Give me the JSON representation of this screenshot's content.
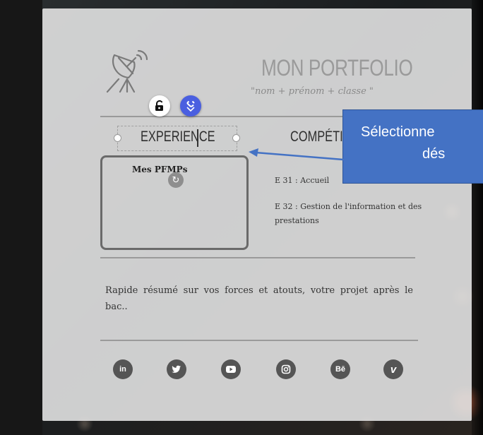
{
  "portfolio": {
    "title": "MON PORTFOLIO",
    "subtitle": "\"nom + prénom + classe \""
  },
  "nav": {
    "experience": "EXPERIENCE",
    "competences": "COMPÉTI"
  },
  "experience_box": {
    "title": "Mes PFMPs"
  },
  "competences": {
    "items": [
      "E 31 : Accueil",
      "E 32 : Gestion de l'information et des prestations"
    ]
  },
  "callout": {
    "line1": "Sélectionne",
    "line2": "dés"
  },
  "summary": {
    "text": "Rapide résumé sur vos forces et atouts, votre projet après le bac.."
  },
  "social": {
    "items": [
      {
        "name": "linkedin",
        "glyph": "in"
      },
      {
        "name": "twitter",
        "glyph": "🐦"
      },
      {
        "name": "youtube",
        "glyph": "▶"
      },
      {
        "name": "instagram",
        "glyph": "◎"
      },
      {
        "name": "behance",
        "glyph": "Bē"
      },
      {
        "name": "vimeo",
        "glyph": "v"
      }
    ]
  },
  "colors": {
    "callout_bg": "#4472c4",
    "tool_blue": "#4a5fe0",
    "card_bg": "#e2e2e2"
  }
}
